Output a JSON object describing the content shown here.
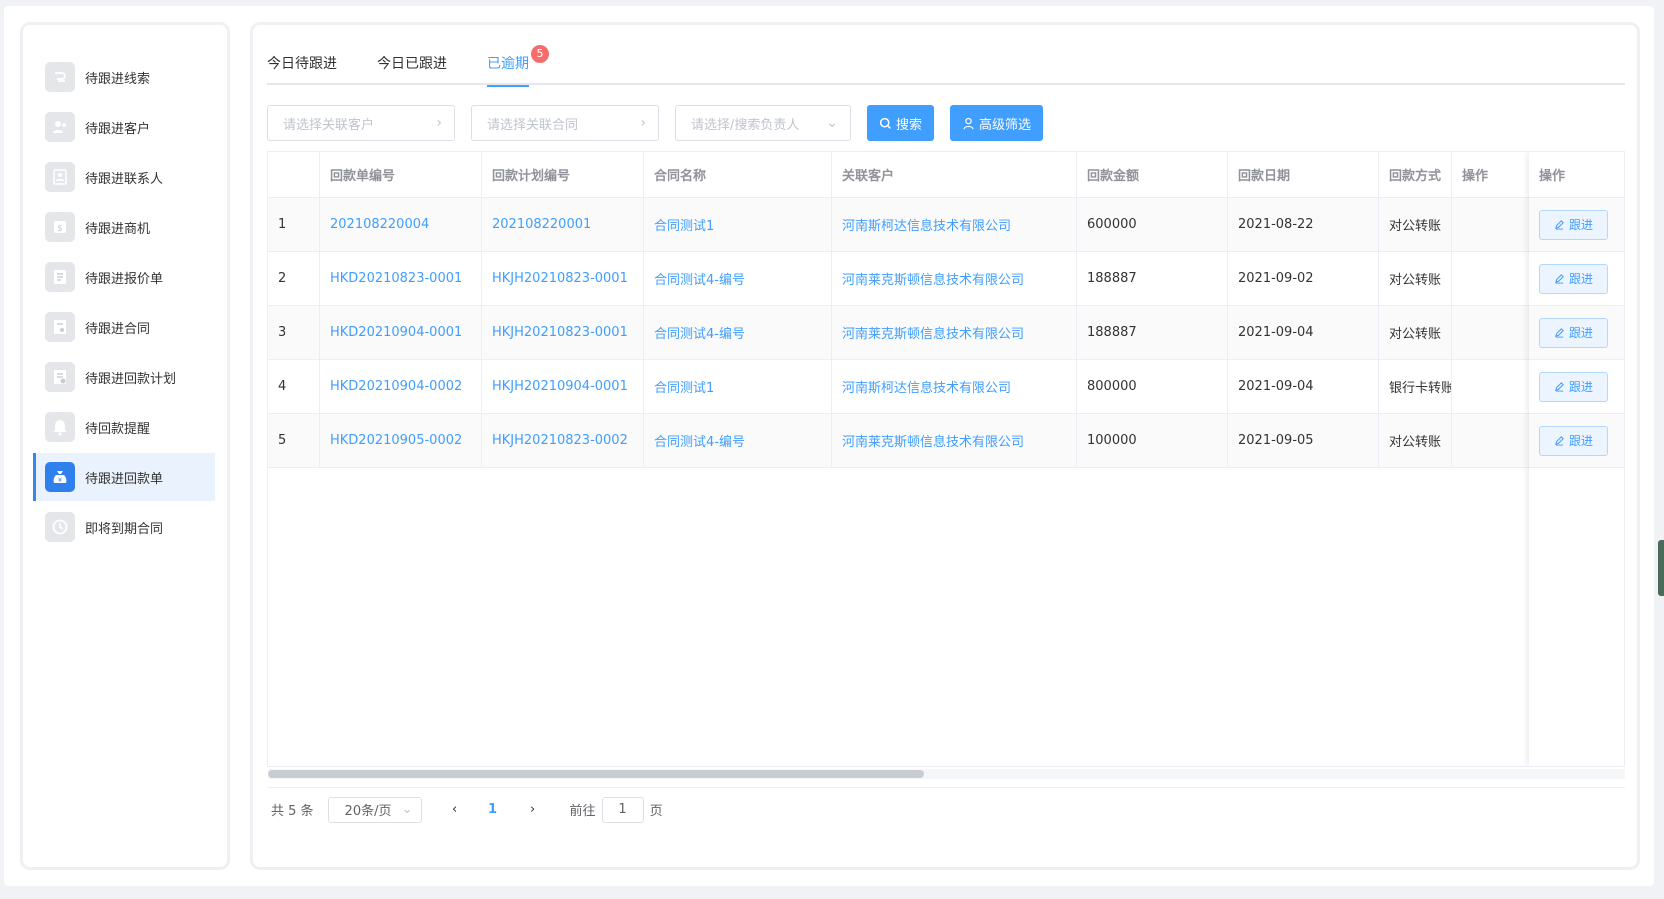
{
  "sidebar": {
    "items": [
      {
        "label": "待跟进线索",
        "icon": "clue-icon"
      },
      {
        "label": "待跟进客户",
        "icon": "customer-icon"
      },
      {
        "label": "待跟进联系人",
        "icon": "contact-icon"
      },
      {
        "label": "待跟进商机",
        "icon": "opportunity-icon"
      },
      {
        "label": "待跟进报价单",
        "icon": "quote-icon"
      },
      {
        "label": "待跟进合同",
        "icon": "contract-icon"
      },
      {
        "label": "待跟进回款计划",
        "icon": "payment-plan-icon"
      },
      {
        "label": "待回款提醒",
        "icon": "bell-icon"
      },
      {
        "label": "待跟进回款单",
        "icon": "money-bag-icon",
        "active": true
      },
      {
        "label": "即将到期合同",
        "icon": "clock-icon"
      }
    ]
  },
  "tabs": [
    {
      "label": "今日待跟进"
    },
    {
      "label": "今日已跟进"
    },
    {
      "label": "已逾期",
      "badge": "5",
      "active": true
    }
  ],
  "filters": {
    "customer_placeholder": "请选择关联客户",
    "contract_placeholder": "请选择关联合同",
    "owner_placeholder": "请选择/搜索负责人",
    "search_label": "搜索",
    "advanced_label": "高级筛选"
  },
  "table": {
    "columns": [
      "",
      "回款单编号",
      "回款计划编号",
      "合同名称",
      "关联客户",
      "回款金额",
      "回款日期",
      "回款方式",
      "操作"
    ],
    "rows": [
      [
        "1",
        "202108220004",
        "202108220001",
        "合同测试1",
        "河南斯柯达信息技术有限公司",
        "600000",
        "2021-08-22",
        "对公转账"
      ],
      [
        "2",
        "HKD20210823-0001",
        "HKJH20210823-0001",
        "合同测试4-编号",
        "河南莱克斯顿信息技术有限公司",
        "188887",
        "2021-09-02",
        "对公转账"
      ],
      [
        "3",
        "HKD20210904-0001",
        "HKJH20210823-0001",
        "合同测试4-编号",
        "河南莱克斯顿信息技术有限公司",
        "188887",
        "2021-09-04",
        "对公转账"
      ],
      [
        "4",
        "HKD20210904-0002",
        "HKJH20210904-0001",
        "合同测试1",
        "河南斯柯达信息技术有限公司",
        "800000",
        "2021-09-04",
        "银行卡转账"
      ],
      [
        "5",
        "HKD20210905-0002",
        "HKJH20210823-0002",
        "合同测试4-编号",
        "河南莱克斯顿信息技术有限公司",
        "100000",
        "2021-09-05",
        "对公转账"
      ]
    ],
    "action_label": "跟进"
  },
  "pagination": {
    "total_text": "共 5 条",
    "page_size": "20条/页",
    "current_page": "1",
    "goto_label": "前往",
    "goto_value": "1",
    "page_suffix": "页"
  },
  "colors": {
    "accent": "#409eff",
    "badge": "#f56c6c"
  }
}
